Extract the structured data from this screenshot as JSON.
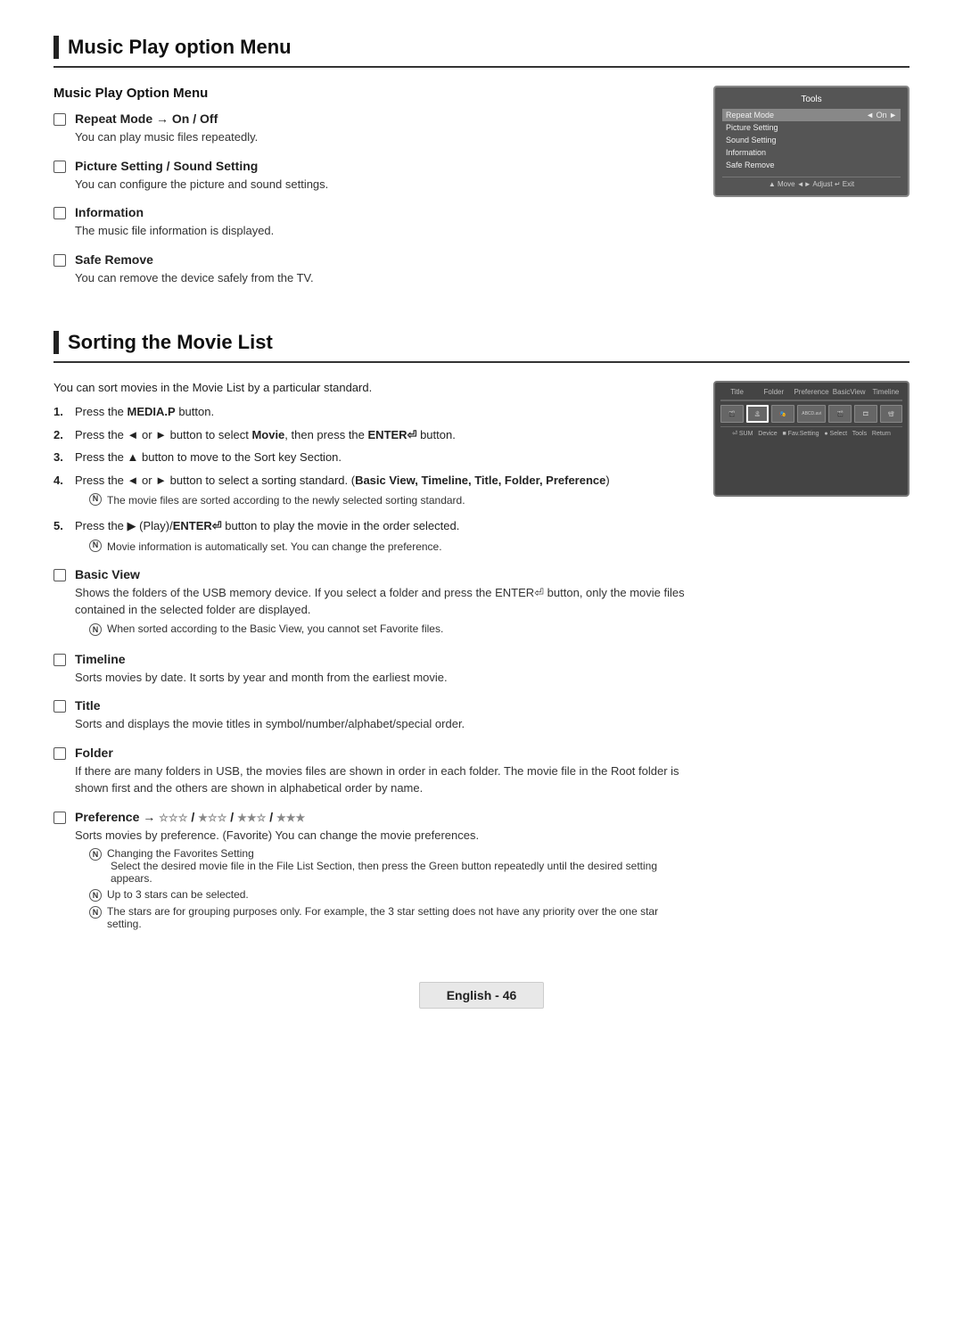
{
  "section1": {
    "title": "Music Play option Menu",
    "sub_heading": "Music Play Option Menu",
    "items": [
      {
        "label": "Repeat Mode → On / Off",
        "desc": "You can play music files repeatedly."
      },
      {
        "label": "Picture Setting / Sound Setting",
        "desc": "You can configure the picture and sound settings."
      },
      {
        "label": "Information",
        "desc": "The music file information is displayed."
      },
      {
        "label": "Safe Remove",
        "desc": "You can remove the device safely from the TV."
      }
    ],
    "tv_menu": {
      "title": "Tools",
      "items": [
        {
          "label": "Repeat Mode",
          "value": "On ▶",
          "selected": true
        },
        {
          "label": "Picture Setting",
          "value": ""
        },
        {
          "label": "Sound Setting",
          "value": ""
        },
        {
          "label": "Information",
          "value": ""
        },
        {
          "label": "Safe Remove",
          "value": ""
        }
      ],
      "footer": "▲ Move   ◄► Adjust   ↵ Exit"
    }
  },
  "section2": {
    "title": "Sorting the Movie List",
    "intro": "You can sort movies in the Movie List by a particular standard.",
    "steps": [
      {
        "num": "1.",
        "text": "Press the MEDIA.P button."
      },
      {
        "num": "2.",
        "text": "Press the ◄ or ► button to select Movie, then press the ENTER⏎ button."
      },
      {
        "num": "3.",
        "text": "Press the ▲ button to move to the Sort key Section."
      },
      {
        "num": "4.",
        "text": "Press the ◄ or ► button to select a sorting standard. (Basic View, Timeline, Title, Folder, Preference)"
      },
      {
        "num": "5.",
        "text": "Press the ▶ (Play)/ENTER⏎ button to play the movie in the order selected."
      }
    ],
    "step4_note": "The movie files are sorted according to the newly selected sorting standard.",
    "step5_note": "Movie information is automatically set. You can change the preference.",
    "items": [
      {
        "label": "Basic View",
        "desc": "Shows the folders of the USB memory device. If you select a folder and press the ENTER⏎ button, only the movie files contained in the selected folder are displayed.",
        "note": "When sorted according to the Basic View, you cannot set Favorite files."
      },
      {
        "label": "Timeline",
        "desc": "Sorts movies by date. It sorts by year and month from the earliest movie.",
        "note": null
      },
      {
        "label": "Title",
        "desc": "Sorts and displays the movie titles in symbol/number/alphabet/special order.",
        "note": null
      },
      {
        "label": "Folder",
        "desc": "If there are many folders in USB, the movies files are shown in order in each folder. The movie file in the Root folder is shown first and the others are shown in alphabetical order by name.",
        "note": null
      },
      {
        "label": "Preference → ☆☆☆ / ★☆☆ / ★★☆ / ★★★",
        "label_plain": "Preference",
        "desc": "Sorts movies by preference. (Favorite) You can change the movie preferences.",
        "note1": "Changing the Favorites Setting",
        "note1_sub": "Select the desired movie file in the File List Section, then press the Green button repeatedly until the desired setting appears.",
        "note2": "Up to 3 stars can be selected.",
        "note3": "The stars are for grouping purposes only. For example, the 3 star setting does not have any priority over the one star setting."
      }
    ],
    "tv_menu": {
      "header": [
        "Title",
        "Folder",
        "Preference",
        "BasicView",
        "Timeline"
      ],
      "thumbnails": [
        "img1",
        "img2",
        "img3",
        "ABCD.avi",
        "img5",
        "img6",
        "img7"
      ],
      "footer": "⏎ SUM   Device   ■ Favorites Setting ● Select  ♪ Tools  ⟵ Return"
    }
  },
  "footer": {
    "text": "English - 46"
  }
}
